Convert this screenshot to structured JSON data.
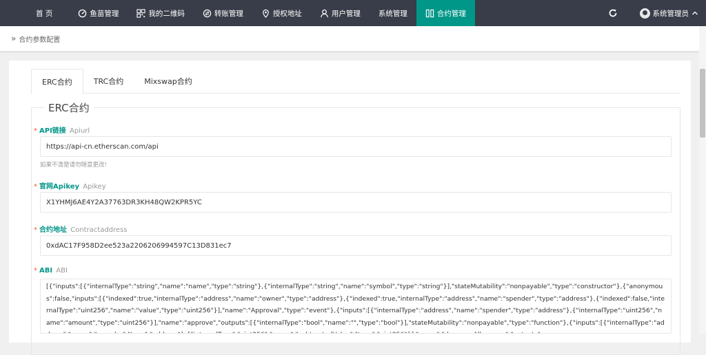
{
  "nav": {
    "items": [
      {
        "label": "首 页",
        "icon": ""
      },
      {
        "label": "鱼苗管理",
        "icon": "dashboard-icon"
      },
      {
        "label": "我的二维码",
        "icon": "qrcode-icon"
      },
      {
        "label": "转账管理",
        "icon": "transfer-icon"
      },
      {
        "label": "授权地址",
        "icon": "location-icon"
      },
      {
        "label": "用户管理",
        "icon": "user-icon"
      },
      {
        "label": "系统管理",
        "icon": ""
      },
      {
        "label": "合约管理",
        "icon": "columns-icon"
      }
    ],
    "active_index": 7,
    "username": "系统管理员",
    "colors": {
      "bar": "#393d49",
      "active": "#009688"
    }
  },
  "breadcrumb": {
    "label": "合约参数配置"
  },
  "tabs": [
    {
      "label": "ERC合约"
    },
    {
      "label": "TRC合约"
    },
    {
      "label": "Mixswap合约"
    }
  ],
  "form": {
    "legend": "ERC合约",
    "apiurl": {
      "label_zh": "API链接",
      "label_en": "Apiurl",
      "value": "https://api-cn.etherscan.com/api",
      "hint": "如果不清楚请勿随意更改!"
    },
    "apikey": {
      "label_zh": "官网Apikey",
      "label_en": "Apikey",
      "value": "X1YHMJ6AE4Y2A37763DR3KH48QW2KPR5YC"
    },
    "contract": {
      "label_zh": "合约地址",
      "label_en": "Contractaddress",
      "value": "0xdAC17F958D2ee523a2206206994597C13D831ec7"
    },
    "abi": {
      "label_zh": "ABI",
      "label_en": "ABI",
      "value": "[{\"inputs\":[{\"internalType\":\"string\",\"name\":\"name\",\"type\":\"string\"},{\"internalType\":\"string\",\"name\":\"symbol\",\"type\":\"string\"}],\"stateMutability\":\"nonpayable\",\"type\":\"constructor\"},{\"anonymous\":false,\"inputs\":[{\"indexed\":true,\"internalType\":\"address\",\"name\":\"owner\",\"type\":\"address\"},{\"indexed\":true,\"internalType\":\"address\",\"name\":\"spender\",\"type\":\"address\"},{\"indexed\":false,\"internalType\":\"uint256\",\"name\":\"value\",\"type\":\"uint256\"}],\"name\":\"Approval\",\"type\":\"event\"},{\"inputs\":[{\"internalType\":\"address\",\"name\":\"spender\",\"type\":\"address\"},{\"internalType\":\"uint256\",\"name\":\"amount\",\"type\":\"uint256\"}],\"name\":\"approve\",\"outputs\":[{\"internalType\":\"bool\",\"name\":\"\",\"type\":\"bool\"}],\"stateMutability\":\"nonpayable\",\"type\":\"function\"},{\"inputs\":[{\"internalType\":\"address\",\"name\":\"spender\",\"type\":\"address\"},{\"internalType\":\"uint256\",\"name\":\"subtractedValue\",\"type\":\"uint256\"}],\"name\":\"decreaseAllowance\",\"outputs\":"
    }
  }
}
